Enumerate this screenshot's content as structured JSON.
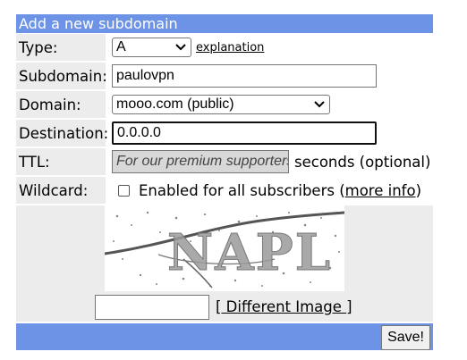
{
  "form": {
    "title": "Add a new subdomain",
    "type": {
      "label": "Type:",
      "selected": "A",
      "link": "explanation"
    },
    "subdomain": {
      "label": "Subdomain:",
      "value": "paulovpn"
    },
    "domain": {
      "label": "Domain:",
      "selected": "mooo.com (public)"
    },
    "destination": {
      "label": "Destination:",
      "value": "0.0.0.0"
    },
    "ttl": {
      "label": "TTL:",
      "value": "For our premium supporters",
      "suffix": "seconds (optional)"
    },
    "wildcard": {
      "label": "Wildcard:",
      "text": "Enabled for all subscribers (",
      "link": "more info",
      "close": ")"
    },
    "captcha": {
      "link_open": "[",
      "link_text": " Different Image ",
      "link_close": "]"
    },
    "save_label": "Save!"
  },
  "colors": {
    "header_bg": "#6c93e6",
    "label_bg": "#ececec"
  }
}
